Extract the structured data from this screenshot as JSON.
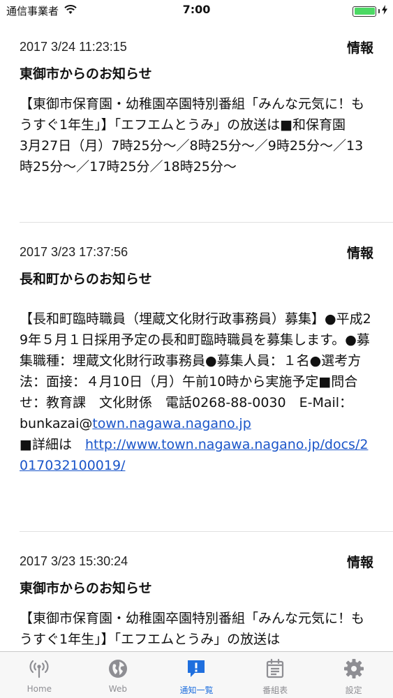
{
  "status_bar": {
    "carrier": "通信事業者",
    "time": "7:00"
  },
  "notices": [
    {
      "date": "2017 3/24 11:23:15",
      "tag": "情報",
      "title": "東御市からのお知らせ",
      "body": "【東御市保育園・幼稚園卒園特別番組「みんな元気に！もうすぐ1年生」】「エフエムとうみ」の放送は■和保育園　　3月27日（月）7時25分～／8時25分～／9時25分～／13時25分～／17時25分／18時25分～"
    },
    {
      "date": "2017 3/23 17:37:56",
      "tag": "情報",
      "title": "長和町からのお知らせ",
      "body_text": "【長和町臨時職員（埋蔵文化財行政事務員）募集】●平成29年５月１日採用予定の長和町臨時職員を募集します。●募集職種：埋蔵文化財行政事務員●募集人員：１名●選考方法：面接：４月10日（月）午前10時から実施予定■問合せ：教育課　文化財係　電話0268-88-0030　E-Mail：",
      "email_prefix": "bunkazai@",
      "email_link": "town.nagawa.nagano.jp",
      "detail_prefix": "■詳細は　",
      "detail_link": "http://www.town.nagawa.nagano.jp/docs/2017032100019/"
    },
    {
      "date": "2017 3/23 15:30:24",
      "tag": "情報",
      "title": "東御市からのお知らせ",
      "body": "【東御市保育園・幼稚園卒園特別番組「みんな元気に！もうすぐ1年生」】「エフエムとうみ」の放送は"
    }
  ],
  "tabs": [
    {
      "label": "Home",
      "icon": "antenna-icon",
      "active": false
    },
    {
      "label": "Web",
      "icon": "globe-icon",
      "active": false
    },
    {
      "label": "通知一覧",
      "icon": "exclamation-bubble-icon",
      "active": true
    },
    {
      "label": "番組表",
      "icon": "calendar-icon",
      "active": false
    },
    {
      "label": "設定",
      "icon": "gear-icon",
      "active": false
    }
  ],
  "colors": {
    "accent": "#1f6fde",
    "link": "#1a55c9",
    "battery": "#4cd964",
    "inactive_tab": "#8e8e93"
  }
}
